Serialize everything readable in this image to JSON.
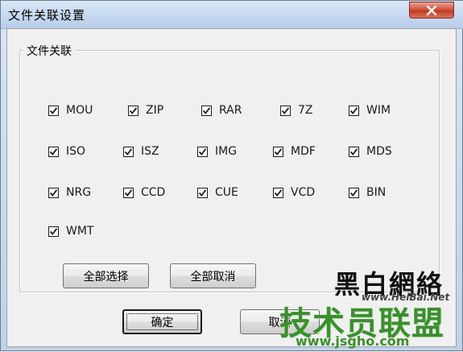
{
  "window": {
    "title": "文件关联设置"
  },
  "group": {
    "label": "文件关联"
  },
  "associations": [
    {
      "label": "MOU",
      "checked": true
    },
    {
      "label": "ZIP",
      "checked": true
    },
    {
      "label": "RAR",
      "checked": true
    },
    {
      "label": "7Z",
      "checked": true
    },
    {
      "label": "WIM",
      "checked": true
    },
    {
      "label": "ISO",
      "checked": true
    },
    {
      "label": "ISZ",
      "checked": true
    },
    {
      "label": "IMG",
      "checked": true
    },
    {
      "label": "MDF",
      "checked": true
    },
    {
      "label": "MDS",
      "checked": true
    },
    {
      "label": "NRG",
      "checked": true
    },
    {
      "label": "CCD",
      "checked": true
    },
    {
      "label": "CUE",
      "checked": true
    },
    {
      "label": "VCD",
      "checked": true
    },
    {
      "label": "BIN",
      "checked": true
    },
    {
      "label": "WMT",
      "checked": true
    }
  ],
  "buttons": {
    "select_all": "全部选择",
    "deselect_all": "全部取消",
    "ok": "确定",
    "cancel": "取消"
  },
  "watermark": {
    "line1": "黑白網絡",
    "line2": "www.HeiBai.Net",
    "line3": "技术员联盟",
    "line4": "www.jsgho.com"
  },
  "colors": {
    "watermark_green": "#3b8f2e",
    "close_red": "#c23a22"
  },
  "icons": {
    "close": "close-icon",
    "check": "checkmark-icon"
  }
}
